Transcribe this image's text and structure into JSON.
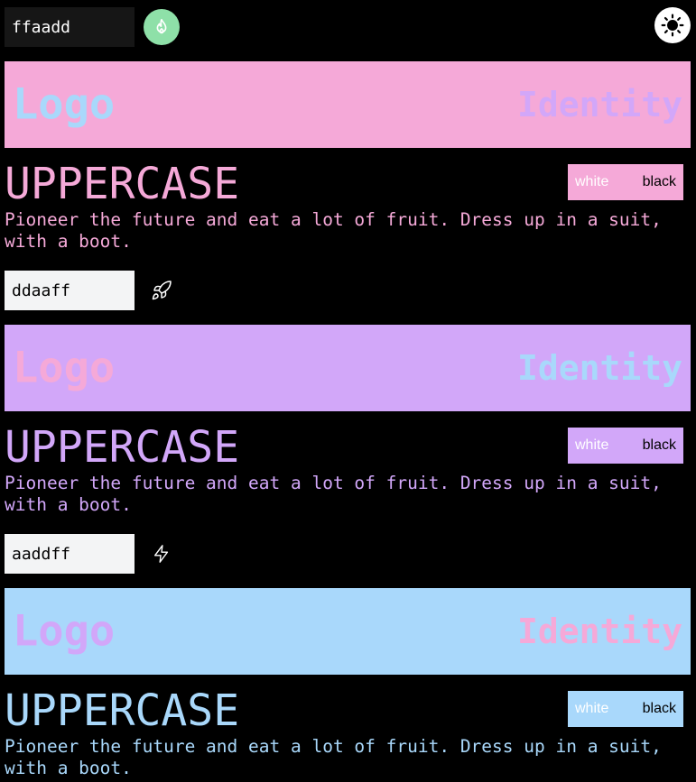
{
  "top_bar": {
    "color_input_value": "ffaadd",
    "action_icon": "flame-icon",
    "theme_icon": "sun-icon"
  },
  "palettes": [
    {
      "color": "#f5a9d8",
      "logo_color": "#a9d8fb",
      "identity_color": "#d2a7f9",
      "banner": {
        "logo": "Logo",
        "identity": "Identity"
      },
      "heading": "UPPERCASE",
      "contrast": {
        "white_label": "white",
        "black_label": "black"
      },
      "paragraph": "Pioneer the future and eat a lot of fruit. Dress up in a suit, with a boot."
    },
    {
      "color": "#d2a7f9",
      "logo_color": "#f5a9d8",
      "identity_color": "#a9d8fb",
      "banner": {
        "logo": "Logo",
        "identity": "Identity"
      },
      "heading": "UPPERCASE",
      "contrast": {
        "white_label": "white",
        "black_label": "black"
      },
      "paragraph": "Pioneer the future and eat a lot of fruit. Dress up in a suit, with a boot."
    },
    {
      "color": "#a9d8fb",
      "logo_color": "#d2a7f9",
      "identity_color": "#f5a9d8",
      "banner": {
        "logo": "Logo",
        "identity": "Identity"
      },
      "heading": "UPPERCASE",
      "contrast": {
        "white_label": "white",
        "black_label": "black"
      },
      "paragraph": "Pioneer the future and eat a lot of fruit. Dress up in a suit, with a boot."
    }
  ],
  "palette_controls": [
    {
      "input_value": "ddaaff",
      "icon": "rocket-icon"
    },
    {
      "input_value": "aaddff",
      "icon": "lightning-icon"
    }
  ],
  "colors": {
    "background": "#000000",
    "flame_button": "#8ee0a8",
    "theme_button": "#ffffff"
  }
}
